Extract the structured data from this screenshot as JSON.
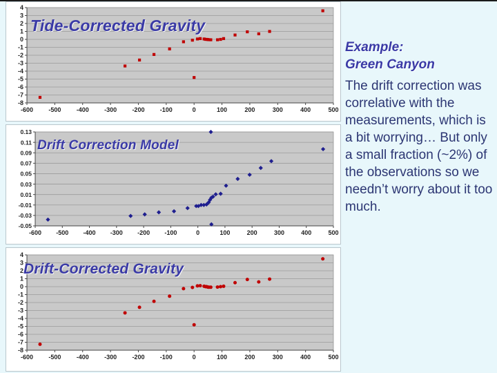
{
  "slide": {
    "background_color": "#e8f7fb",
    "accent_color": "#3a3aa6",
    "body_text_color": "#2c3673"
  },
  "sidebar": {
    "heading_line_1": "Example:",
    "heading_line_2": "Green Canyon",
    "body": "The drift correction was correlative with the measurements, which is a bit worrying… But only a small fraction (~2%) of the observations so we needn’t worry about it too much."
  },
  "chart_data": [
    {
      "id": "tide-corrected-gravity",
      "type": "scatter",
      "title": "Tide-Corrected Gravity",
      "xlabel": "",
      "ylabel": "",
      "xlim": [
        -600,
        500
      ],
      "ylim": [
        -8,
        4
      ],
      "xticks": [
        -600,
        -500,
        -400,
        -300,
        -200,
        -100,
        0,
        100,
        200,
        300,
        400,
        500
      ],
      "yticks": [
        -8,
        -7,
        -6,
        -5,
        -4,
        -3,
        -2,
        -1,
        0,
        1,
        2,
        3,
        4
      ],
      "xticklabels": [
        "-600",
        "-500",
        "-400",
        "-300",
        "-200",
        "-100",
        "0",
        "100",
        "200",
        "300",
        "400",
        "500"
      ],
      "yticklabels": [
        "-8",
        "-7",
        "-6",
        "-5",
        "-4",
        "-3",
        "-2",
        "-1",
        "0",
        "1",
        "2",
        "3",
        "4"
      ],
      "grid": "horizontal",
      "plot_bg": "#c9c9c9",
      "marker_color": "#c00000",
      "marker": "square",
      "points": [
        [
          -553,
          -7.3
        ],
        [
          -248,
          -3.35
        ],
        [
          -196,
          -2.6
        ],
        [
          -144,
          -1.9
        ],
        [
          -88,
          -1.2
        ],
        [
          -38,
          -0.3
        ],
        [
          -6,
          -0.1
        ],
        [
          12,
          0.05
        ],
        [
          22,
          0.1
        ],
        [
          36,
          0.05
        ],
        [
          41,
          0.0
        ],
        [
          45,
          0.0
        ],
        [
          49,
          -0.02
        ],
        [
          53,
          -0.04
        ],
        [
          60,
          -0.05
        ],
        [
          84,
          -0.05
        ],
        [
          95,
          0.0
        ],
        [
          106,
          0.1
        ],
        [
          147,
          0.55
        ],
        [
          191,
          0.95
        ],
        [
          232,
          0.7
        ],
        [
          271,
          1.0
        ],
        [
          462,
          3.6
        ],
        [
          0,
          -4.8
        ]
      ]
    },
    {
      "id": "drift-correction-model",
      "type": "scatter",
      "title": "Drift Correction Model",
      "xlabel": "",
      "ylabel": "",
      "xlim": [
        -600,
        500
      ],
      "ylim": [
        -0.05,
        0.13
      ],
      "xticks": [
        -600,
        -500,
        -400,
        -300,
        -200,
        -100,
        0,
        100,
        200,
        300,
        400,
        500
      ],
      "yticks": [
        -0.05,
        -0.03,
        -0.01,
        0.01,
        0.03,
        0.05,
        0.07,
        0.09,
        0.11,
        0.13
      ],
      "xticklabels": [
        "-600",
        "-500",
        "-400",
        "-300",
        "-200",
        "-100",
        "0",
        "100",
        "200",
        "300",
        "400",
        "500"
      ],
      "yticklabels": [
        "-0.05",
        "-0.03",
        "-0.01",
        "0.01",
        "0.03",
        "0.05",
        "0.07",
        "0.09",
        "0.11",
        "0.13"
      ],
      "grid": "horizontal",
      "plot_bg": "#c9c9c9",
      "marker_color": "#1f1f8f",
      "marker": "diamond",
      "points": [
        [
          -553,
          -0.038
        ],
        [
          -248,
          -0.031
        ],
        [
          -196,
          -0.028
        ],
        [
          -144,
          -0.024
        ],
        [
          -88,
          -0.022
        ],
        [
          -38,
          -0.016
        ],
        [
          -6,
          -0.012
        ],
        [
          2,
          -0.012
        ],
        [
          12,
          -0.01
        ],
        [
          22,
          -0.01
        ],
        [
          32,
          -0.009
        ],
        [
          40,
          -0.005
        ],
        [
          45,
          0.0
        ],
        [
          50,
          0.004
        ],
        [
          56,
          0.006
        ],
        [
          66,
          0.0105
        ],
        [
          84,
          0.0115
        ],
        [
          104,
          0.027
        ],
        [
          147,
          0.04
        ],
        [
          191,
          0.048
        ],
        [
          232,
          0.061
        ],
        [
          271,
          0.074
        ],
        [
          462,
          0.097
        ],
        [
          48,
          0.13
        ],
        [
          50,
          -0.047
        ]
      ]
    },
    {
      "id": "drift-corrected-gravity",
      "type": "scatter",
      "title": "Drift-Corrected Gravity",
      "xlabel": "",
      "ylabel": "",
      "xlim": [
        -600,
        500
      ],
      "ylim": [
        -8,
        4
      ],
      "xticks": [
        -600,
        -500,
        -400,
        -300,
        -200,
        -100,
        0,
        100,
        200,
        300,
        400,
        500
      ],
      "yticks": [
        -8,
        -7,
        -6,
        -5,
        -4,
        -3,
        -2,
        -1,
        0,
        1,
        2,
        3,
        4
      ],
      "xticklabels": [
        "-600",
        "-500",
        "-400",
        "-300",
        "-200",
        "-100",
        "0",
        "100",
        "200",
        "300",
        "400",
        "500"
      ],
      "yticklabels": [
        "-8",
        "-7",
        "-6",
        "-5",
        "-4",
        "-3",
        "-2",
        "-1",
        "0",
        "1",
        "2",
        "3",
        "4"
      ],
      "grid": "horizontal",
      "plot_bg": "#c9c9c9",
      "marker_color": "#c00000",
      "marker": "circle",
      "points": [
        [
          -553,
          -7.25
        ],
        [
          -248,
          -3.3
        ],
        [
          -196,
          -2.6
        ],
        [
          -144,
          -1.85
        ],
        [
          -88,
          -1.2
        ],
        [
          -38,
          -0.25
        ],
        [
          -6,
          -0.1
        ],
        [
          12,
          0.1
        ],
        [
          22,
          0.12
        ],
        [
          36,
          0.05
        ],
        [
          41,
          0.0
        ],
        [
          45,
          0.0
        ],
        [
          49,
          -0.05
        ],
        [
          53,
          -0.07
        ],
        [
          60,
          -0.07
        ],
        [
          84,
          -0.05
        ],
        [
          95,
          0.0
        ],
        [
          106,
          0.05
        ],
        [
          147,
          0.5
        ],
        [
          191,
          0.9
        ],
        [
          232,
          0.6
        ],
        [
          271,
          0.95
        ],
        [
          462,
          3.5
        ],
        [
          0,
          -4.8
        ]
      ]
    }
  ]
}
